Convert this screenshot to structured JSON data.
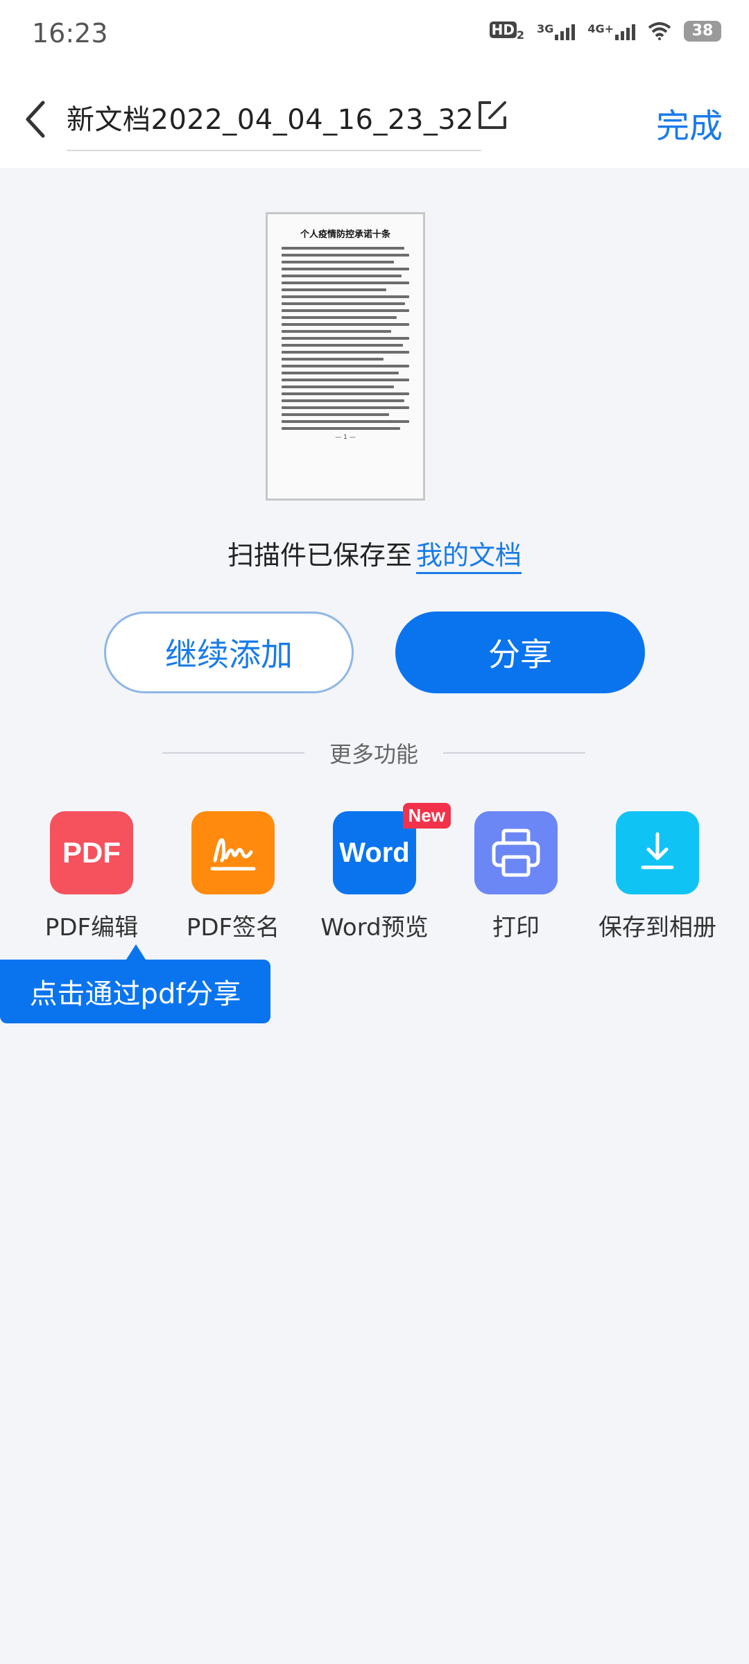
{
  "status_bar": {
    "time": "16:23",
    "hd_label": "HD",
    "hd_sub": "2",
    "net1": "3G",
    "net2": "4G+",
    "battery": "38"
  },
  "header": {
    "back_icon": "chevron-left-icon",
    "title": "新文档2022_04_04_16_23_32",
    "edit_icon": "edit-icon",
    "done_label": "完成"
  },
  "preview": {
    "doc_title": "个人疫情防控承诺十条",
    "page_number": "— 1 —"
  },
  "saved": {
    "text": "扫描件已保存至",
    "link": "我的文档"
  },
  "actions": {
    "continue_label": "继续添加",
    "share_label": "分享"
  },
  "more": {
    "label": "更多功能",
    "tools": [
      {
        "label": "PDF编辑",
        "icon_text": "PDF",
        "icon": "pdf-icon",
        "color": "#f5525e"
      },
      {
        "label": "PDF签名",
        "icon": "signature-icon",
        "color": "#ff8a0d"
      },
      {
        "label": "Word预览",
        "icon_text": "Word",
        "icon": "word-icon",
        "color": "#0a74ef",
        "badge": "New"
      },
      {
        "label": "打印",
        "icon": "printer-icon",
        "color": "#6b86f5"
      },
      {
        "label": "保存到相册",
        "icon": "download-icon",
        "color": "#10c3f5"
      }
    ]
  },
  "tooltip": {
    "text": "点击通过pdf分享"
  },
  "colors": {
    "accent": "#1a7be8",
    "primary_button": "#0a74ef",
    "background": "#f3f5f9"
  }
}
